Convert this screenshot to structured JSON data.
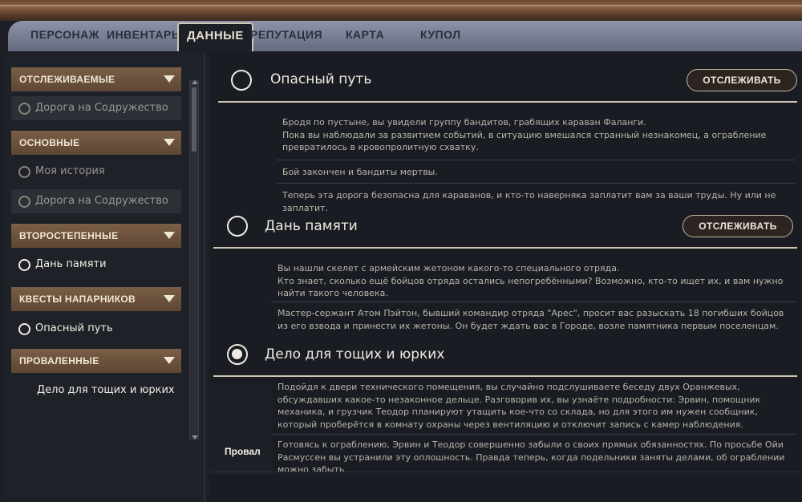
{
  "tabs": [
    {
      "label": "ПЕРСОНАЖ"
    },
    {
      "label": "ИНВЕНТАРЬ"
    },
    {
      "label": "ДАННЫЕ"
    },
    {
      "label": "РЕПУТАЦИЯ"
    },
    {
      "label": "КАРТА"
    },
    {
      "label": "КУПОЛ"
    }
  ],
  "sidebar": {
    "categories": [
      {
        "label": "ОТСЛЕЖИВАЕМЫЕ",
        "items": [
          "Дорога на Содружество"
        ]
      },
      {
        "label": "ОСНОВНЫЕ",
        "items": [
          "Моя история",
          "Дорога на Содружество"
        ]
      },
      {
        "label": "ВТОРОСТЕПЕННЫЕ",
        "items": [
          "Дань памяти"
        ]
      },
      {
        "label": "КВЕСТЫ НАПАРНИКОВ",
        "items": [
          "Опасный путь"
        ]
      },
      {
        "label": "ПРОВАЛЕННЫЕ",
        "items": [
          "Дело для тощих и юрких"
        ]
      }
    ]
  },
  "quests": [
    {
      "title": "Опасный путь",
      "button": "ОТСЛЕЖИВАТЬ",
      "paragraphs": [
        "Бродя по пустыне, вы увидели группу бандитов, грабящих караван Фаланги.\nПока вы наблюдали за развитием событий, в ситуацию вмешался странный незнакомец, а ограбление превратилось в кровопролитную схватку.",
        "Бой закончен и бандиты мертвы.",
        "Теперь эта дорога безопасна для караванов, и кто-то наверняка заплатит вам за ваши труды. Ну или не заплатит."
      ]
    },
    {
      "title": "Дань памяти",
      "button": "ОТСЛЕЖИВАТЬ",
      "paragraphs": [
        "Вы нашли скелет с армейским жетоном какого-то специального отряда.\nКто знает, сколько ещё бойцов отряда остались непогребёнными? Возможно, кто-то ищет их, и вам нужно найти такого человека.",
        "Мастер-сержант Атом Пэйтон, бывший командир отряда \"Арес\", просит вас разыскать 18 погибших бойцов из его взвода и принести их жетоны. Он будет ждать вас в Городе, возле памятника первым поселенцам."
      ]
    },
    {
      "title": "Дело для тощих и юрких",
      "status": "Провал",
      "paragraphs": [
        "Подойдя к двери технического помещения, вы случайно подслушиваете беседу двух Оранжевых, обсуждавших какое-то незаконное дельце. Разговорив их, вы узнаёте подробности: Эрвин, помощник механика, и грузчик Теодор планируют утащить кое-что со склада, но для этого им нужен сообщник, который проберётся в комнату охраны через вентиляцию и отключит запись с камер наблюдения.",
        "Готовясь к ограблению, Эрвин и Теодор совершенно забыли о своих прямых обязанностях. По просьбе Ойи Расмуссен вы устранили эту оплошность. Правда теперь, когда подельники заняты делами, об ограблении можно забыть."
      ]
    }
  ],
  "colors": {
    "accent_brown": "#7a5e46",
    "tabs_bar": "#8d93a8",
    "panel_bg": "#191c22"
  }
}
